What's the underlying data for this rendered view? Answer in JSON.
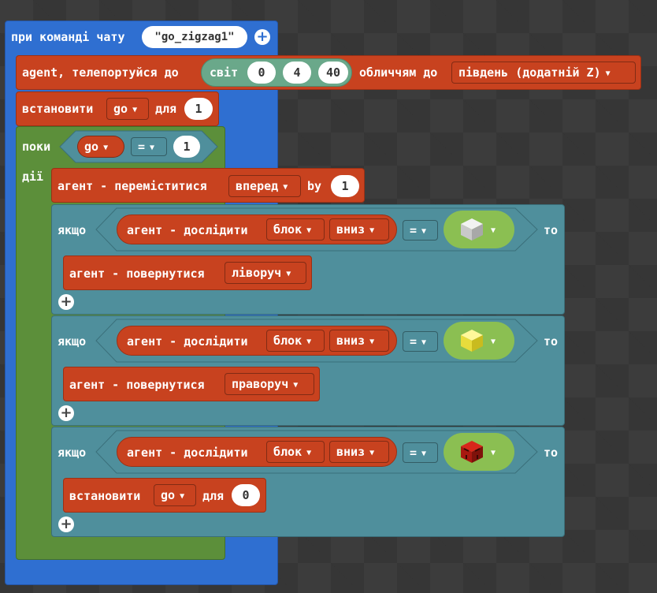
{
  "event": {
    "label": "при команді чату",
    "command": "\"go_zigzag1\""
  },
  "teleport": {
    "label": "agent, телепортуйся до",
    "world": "світ",
    "x": "0",
    "y": "4",
    "z": "40",
    "facing_label": "обличчям до",
    "direction": "південь (додатній Z)"
  },
  "set1": {
    "label": "встановити",
    "var": "go",
    "for": "для",
    "value": "1"
  },
  "while": {
    "label": "поки",
    "do": "дії",
    "var": "go",
    "op": "=",
    "value": "1"
  },
  "move": {
    "label": "агент - переміститися",
    "direction": "вперед",
    "by": "by",
    "value": "1"
  },
  "if_blocks": [
    {
      "if": "якщо",
      "then": "то",
      "inspect": "агент - дослідити",
      "kind": "блок",
      "dir": "вниз",
      "op": "=",
      "block": "white-block",
      "action_label": "агент - повернутися",
      "action_value": "ліворуч"
    },
    {
      "if": "якщо",
      "then": "то",
      "inspect": "агент - дослідити",
      "kind": "блок",
      "dir": "вниз",
      "op": "=",
      "block": "yellow-block",
      "action_label": "агент - повернутися",
      "action_value": "праворуч"
    },
    {
      "if": "якщо",
      "then": "то",
      "inspect": "агент - дослідити",
      "kind": "блок",
      "dir": "вниз",
      "op": "=",
      "block": "redstone-block",
      "action_label": "встановити",
      "action_var": "go",
      "action_for": "для",
      "action_value": "0"
    }
  ],
  "colors": {
    "event": "#2f6fd1",
    "agent": "#c8421f",
    "loop": "#5c8f3a",
    "logic": "#4f8f9c",
    "world": "#6aa88a",
    "compare_bg": "#8bbf52"
  },
  "icons": {
    "add": "plus-circle-icon",
    "dropdown": "triangle-down-icon"
  }
}
